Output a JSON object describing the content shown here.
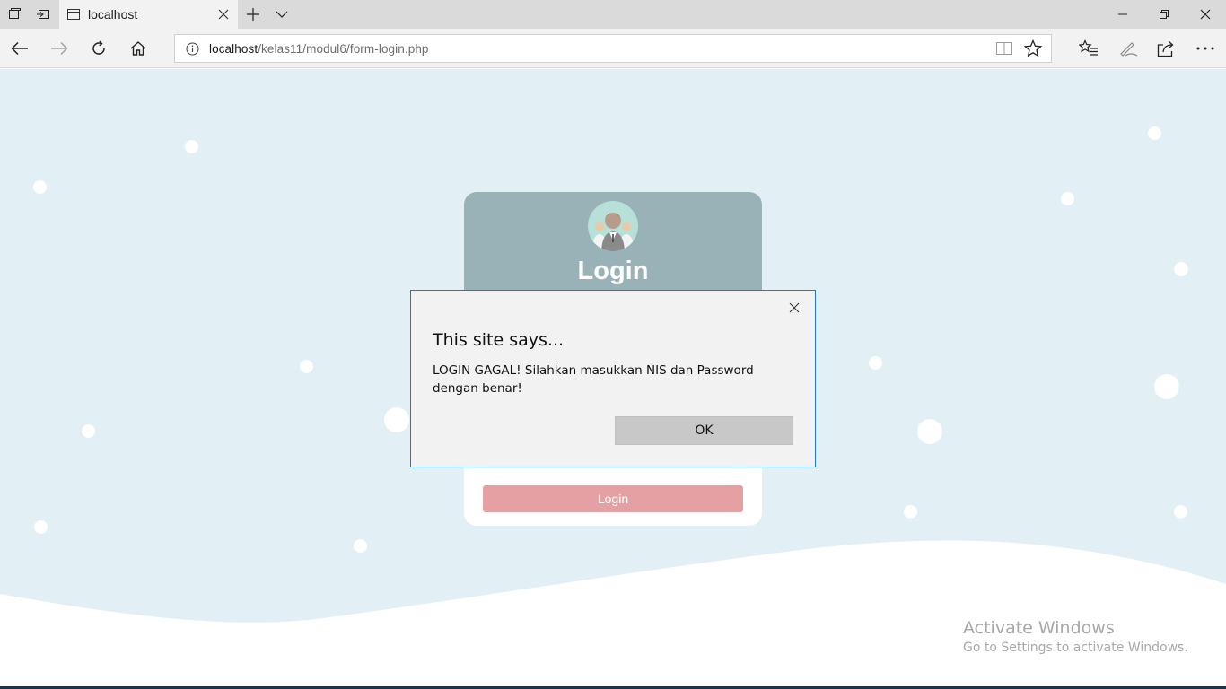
{
  "browser": {
    "tab_title": "localhost",
    "url_host": "localhost",
    "url_path": "/kelas11/modul6/form-login.php",
    "icons": [
      "tab-actions-icon",
      "set-aside-tabs-icon",
      "page-icon",
      "close-icon",
      "new-tab-icon",
      "chevron-down-icon",
      "minimize-icon",
      "restore-icon",
      "close-window-icon",
      "back-icon",
      "forward-icon",
      "refresh-icon",
      "home-icon",
      "info-icon",
      "reading-view-icon",
      "favorite-star-icon",
      "favorites-hub-icon",
      "notes-pen-icon",
      "share-icon",
      "more-icon"
    ]
  },
  "login_card": {
    "title": "Login",
    "button_label": "Login",
    "header_color": "#98b2b8",
    "button_color": "#e4a0a2"
  },
  "dialog": {
    "title": "This site says...",
    "message": "LOGIN GAGAL! Silahkan masukkan NIS dan Password dengan benar!",
    "ok_label": "OK"
  },
  "watermark": {
    "title": "Activate Windows",
    "subtitle": "Go to Settings to activate Windows."
  },
  "colors": {
    "page_background": "#e2f0f5",
    "dialog_border": "#1e7ad0"
  }
}
